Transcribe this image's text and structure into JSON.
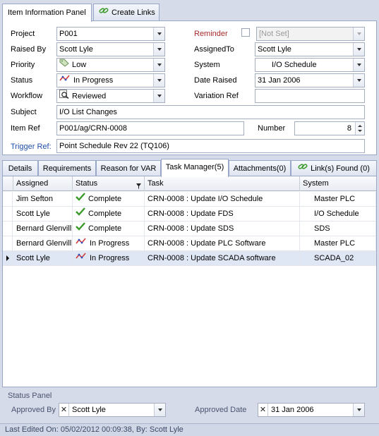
{
  "top_tabs": [
    "Item Information Panel",
    "Create Links"
  ],
  "form": {
    "project_label": "Project",
    "project_value": "P001",
    "raised_by_label": "Raised By",
    "raised_by_value": "Scott Lyle",
    "priority_label": "Priority",
    "priority_value": "Low",
    "status_label": "Status",
    "status_value": "In Progress",
    "workflow_label": "Workflow",
    "workflow_value": "Reviewed",
    "subject_label": "Subject",
    "subject_value": "I/O List Changes",
    "item_ref_label": "Item Ref",
    "item_ref_value": "P001/ag/CRN-0008",
    "trigger_ref_label": "Trigger Ref:",
    "trigger_ref_value": "Point Schedule Rev 22 (TQ106)",
    "reminder_label": "Reminder",
    "reminder_value": "[Not Set]",
    "assigned_to_label": "AssignedTo",
    "assigned_to_value": "Scott Lyle",
    "system_label": "System",
    "system_value": "I/O Schedule",
    "date_raised_label": "Date Raised",
    "date_raised_value": "31 Jan 2006",
    "variation_ref_label": "Variation Ref",
    "variation_ref_value": "",
    "number_label": "Number",
    "number_value": "8"
  },
  "detail_tabs": [
    "Details",
    "Requirements",
    "Reason for VAR",
    "Task Manager(5)",
    "Attachments(0)",
    "Link(s) Found (0)"
  ],
  "grid": {
    "columns": [
      "Assigned",
      "Status",
      "Task",
      "System"
    ],
    "rows": [
      {
        "assigned": "Jim Sefton",
        "status": "Complete",
        "task": "CRN-0008 : Update I/O Schedule",
        "system": "Master PLC"
      },
      {
        "assigned": "Scott Lyle",
        "status": "Complete",
        "task": "CRN-0008 : Update FDS",
        "system": "I/O Schedule"
      },
      {
        "assigned": "Bernard Glenvill",
        "status": "Complete",
        "task": "CRN-0008 : Update SDS",
        "system": "SDS"
      },
      {
        "assigned": "Bernard Glenvill",
        "status": "In Progress",
        "task": "CRN-0008 : Update PLC Software",
        "system": "Master PLC"
      },
      {
        "assigned": "Scott Lyle",
        "status": "In Progress",
        "task": "CRN-0008 : Update SCADA software",
        "system": "SCADA_02"
      }
    ]
  },
  "status_panel": {
    "title": "Status Panel",
    "approved_by_label": "Approved By",
    "approved_by_value": "Scott Lyle",
    "approved_date_label": "Approved Date",
    "approved_date_value": "31 Jan 2006"
  },
  "footer": "Last Edited On: 05/02/2012 00:09:38, By: Scott Lyle",
  "colors": {
    "complete_check": "#3a9a2a",
    "in_progress": "#d23a3a",
    "reminder_label": "#a52a2a",
    "trigger_label": "#1f4fa8"
  }
}
